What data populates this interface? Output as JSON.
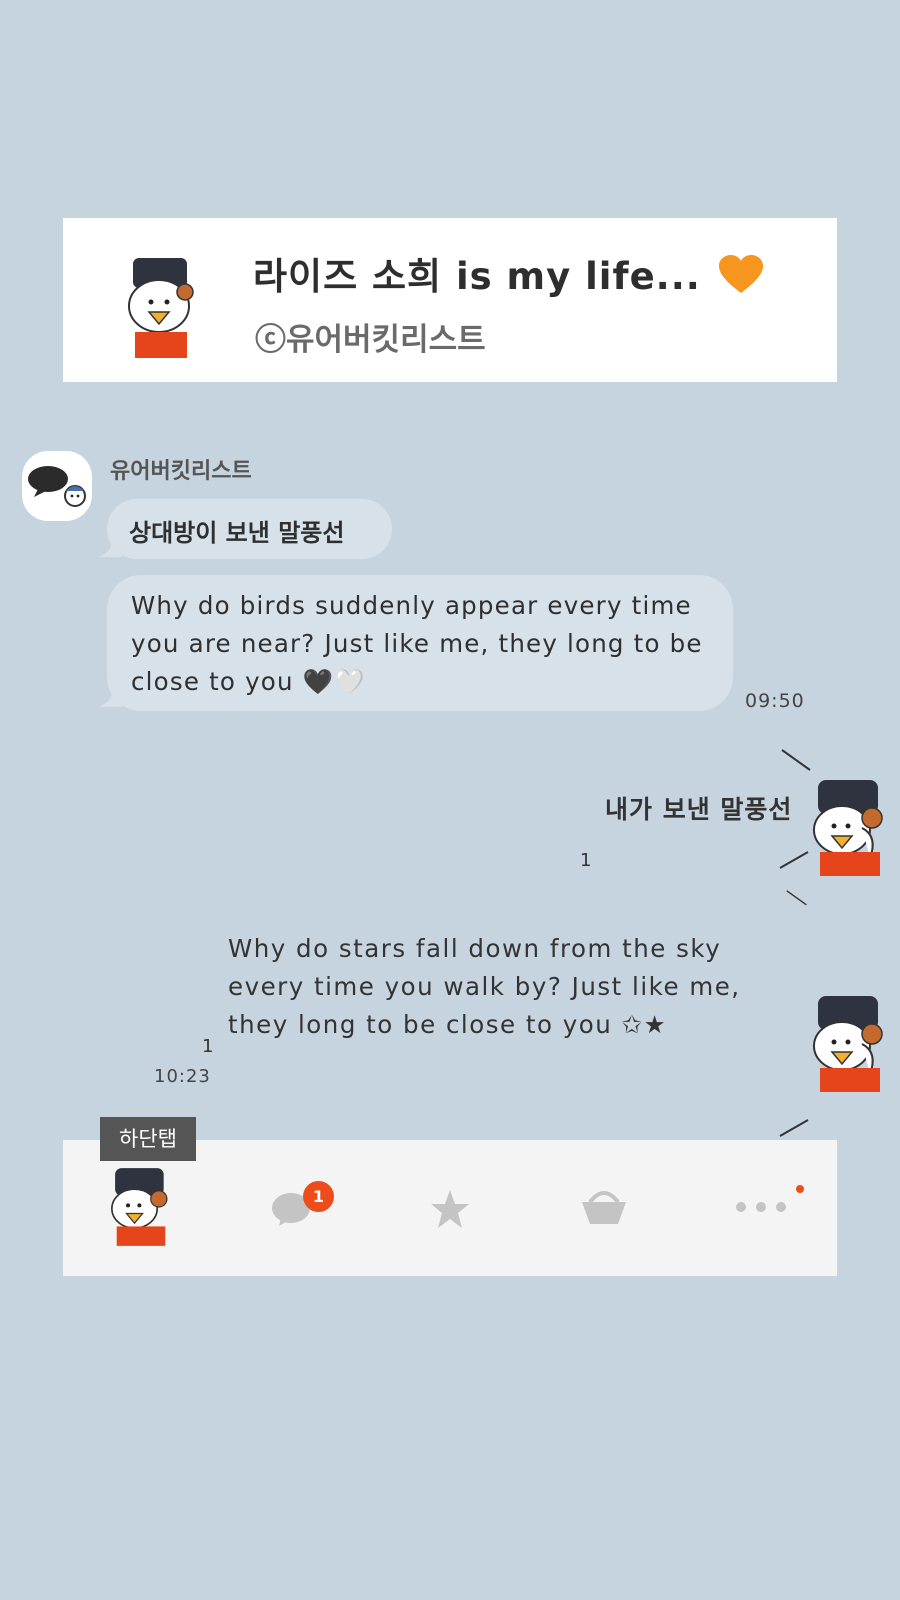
{
  "preview": {
    "title": "라이즈 소희 is my life...",
    "subtitle": "ⓒ유어버킷리스트",
    "heart_icon": "orange-heart-icon"
  },
  "received": {
    "sender_name": "유어버킷리스트",
    "messages": [
      "상대방이 보낸 말풍선",
      "Why do birds suddenly appear every time you are near? Just like me, they long to be close to you 🖤🤍"
    ],
    "time": "09:50"
  },
  "sent": {
    "messages": [
      "내가 보낸 말풍선",
      "Why do stars fall down from the sky every time you walk by? Just like me, they long to be close to you ✩★"
    ],
    "read_counts": [
      "1",
      "1"
    ],
    "time": "10:23"
  },
  "tabbar": {
    "label": "하단탭",
    "tabs": [
      {
        "icon": "profile-avatar-icon"
      },
      {
        "icon": "chat-bubble-icon",
        "badge": "1"
      },
      {
        "icon": "star-icon"
      },
      {
        "icon": "basket-icon"
      },
      {
        "icon": "more-dots-icon"
      }
    ]
  },
  "colors": {
    "background": "#c6d4e0",
    "bubble": "#d6e1ea",
    "badge": "#ee4c1a"
  }
}
